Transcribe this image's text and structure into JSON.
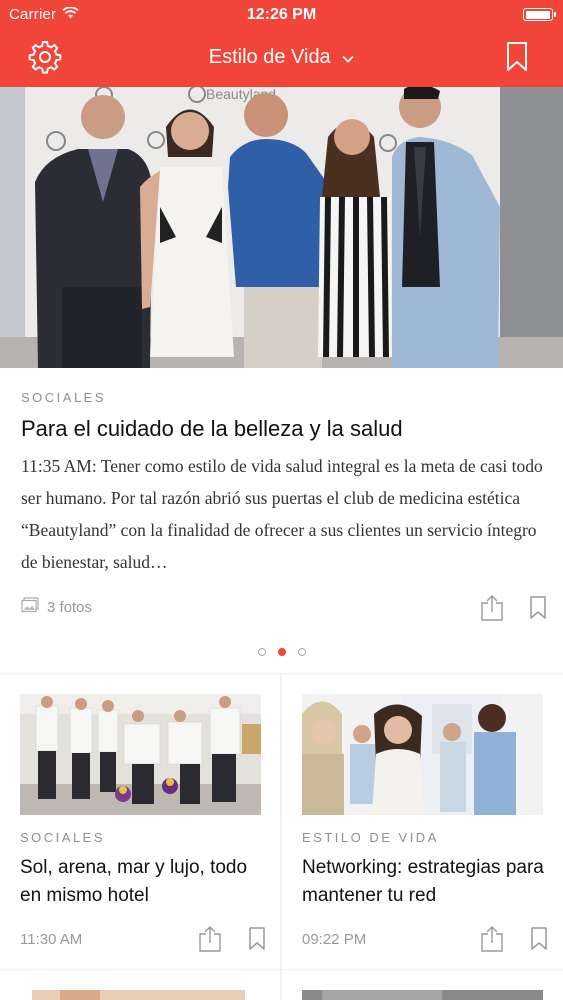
{
  "status_bar": {
    "carrier": "Carrier",
    "time": "12:26 PM",
    "battery_level": 1.0
  },
  "nav": {
    "title": "Estilo de Vida",
    "icons": [
      "gear-icon",
      "chevron-down-icon",
      "bookmark-icon"
    ]
  },
  "featured": {
    "section": "SOCIALES",
    "title": "Para el cuidado de la belleza y la salud",
    "body": "11:35 AM: Tener como estilo de vida salud integral es la meta de casi todo ser humano. Por tal razón abrió sus puertas el club de medicina estética “Beautyland” con la finalidad de ofrecer a sus clientes un servicio íntegro de bienestar, salud…",
    "photos_label": "3 fotos",
    "image_banner_text": "Beautyland"
  },
  "pager": {
    "count": 3,
    "active_index": 1
  },
  "cards": [
    {
      "section": "SOCIALES",
      "title": "Sol, arena, mar y lujo, todo en mismo hotel",
      "time": "11:30 AM"
    },
    {
      "section": "ESTILO DE VIDA",
      "title": "Networking: estrategias para mantener tu red",
      "time": "09:22 PM"
    }
  ],
  "colors": {
    "brand_red": "#f24539",
    "label_gray": "#8f8f8f",
    "divider": "#f2f2f2"
  }
}
